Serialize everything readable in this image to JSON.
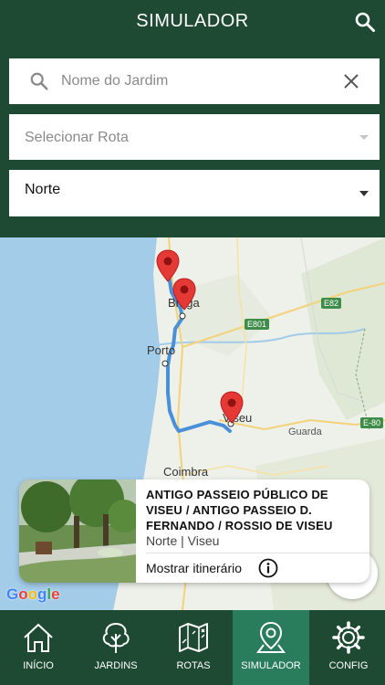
{
  "header": {
    "title": "SIMULADOR",
    "search_icon": "search-icon"
  },
  "search": {
    "placeholder": "Nome do Jardim",
    "value": ""
  },
  "route_select": {
    "selected": "Selecionar Rota"
  },
  "region_select": {
    "selected": "Norte"
  },
  "map": {
    "labels": {
      "braga": "Braga",
      "porto": "Porto",
      "viseu": "Viseu",
      "guarda": "Guarda",
      "coimbra": "Coimbra"
    },
    "roads": {
      "e82": "E82",
      "e801": "E801",
      "e80": "E-80"
    },
    "attribution": "Google",
    "colors": {
      "route": "#4a90d9",
      "pin": "#e53935",
      "water": "#a3cce9"
    }
  },
  "info_card": {
    "name": "ANTIGO PASSEIO PÚBLICO DE VISEU / ANTIGO PASSEIO D. FERNANDO / ROSSIO DE VISEU",
    "region": "Norte | Viseu",
    "route_link": "Mostrar itinerário"
  },
  "tabs": [
    {
      "label": "INÍCIO",
      "icon": "home-icon",
      "active": false
    },
    {
      "label": "JARDINS",
      "icon": "tree-icon",
      "active": false
    },
    {
      "label": "ROTAS",
      "icon": "map-icon",
      "active": false
    },
    {
      "label": "SIMULADOR",
      "icon": "map-pin-icon",
      "active": true
    },
    {
      "label": "CONFIG",
      "icon": "gear-icon",
      "active": false
    }
  ],
  "colors": {
    "brand": "#1e4a33",
    "active_tab": "#2a7d5c"
  }
}
